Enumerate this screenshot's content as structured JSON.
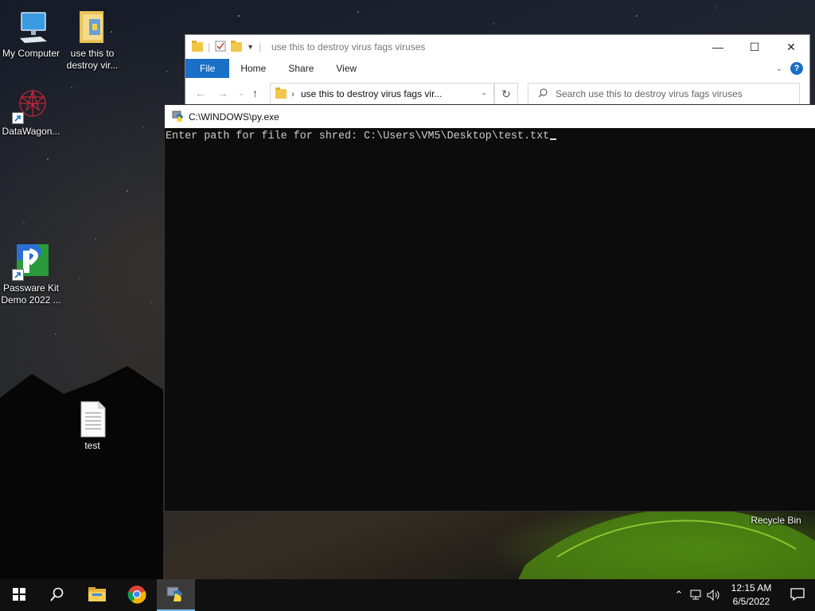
{
  "desktop": {
    "icons": [
      {
        "label": "My Computer"
      },
      {
        "label": "use this to destroy vir..."
      },
      {
        "label": "DataWagon..."
      },
      {
        "label": "Passware Kit Demo 2022 ..."
      },
      {
        "label": "test"
      },
      {
        "label": "Recycle Bin"
      }
    ]
  },
  "explorer": {
    "title": "use this to destroy virus fags viruses",
    "tabs": [
      {
        "label": "File"
      },
      {
        "label": "Home"
      },
      {
        "label": "Share"
      },
      {
        "label": "View"
      }
    ],
    "address": "use this to destroy virus fags vir...",
    "search_placeholder": "Search use this to destroy virus fags viruses",
    "help_glyph": "?"
  },
  "console": {
    "title": "C:\\WINDOWS\\py.exe",
    "prompt": "Enter path for file for shred: ",
    "input": "C:\\Users\\VM5\\Desktop\\test.txt"
  },
  "taskbar": {
    "pinned": [
      {
        "name": "start-button",
        "icon": "windows-logo-icon"
      },
      {
        "name": "search-button",
        "icon": "search-icon"
      },
      {
        "name": "file-explorer",
        "icon": "folder-icon"
      },
      {
        "name": "chrome",
        "icon": "chrome-icon"
      },
      {
        "name": "python",
        "icon": "python-icon",
        "active": true
      }
    ],
    "clock": {
      "time": "12:15 AM",
      "date": "6/5/2022"
    }
  },
  "colors": {
    "accent": "#1a6fc6",
    "console_bg": "#0c0c0c",
    "console_text": "#cccccc",
    "taskbar_bg": "#101010"
  }
}
